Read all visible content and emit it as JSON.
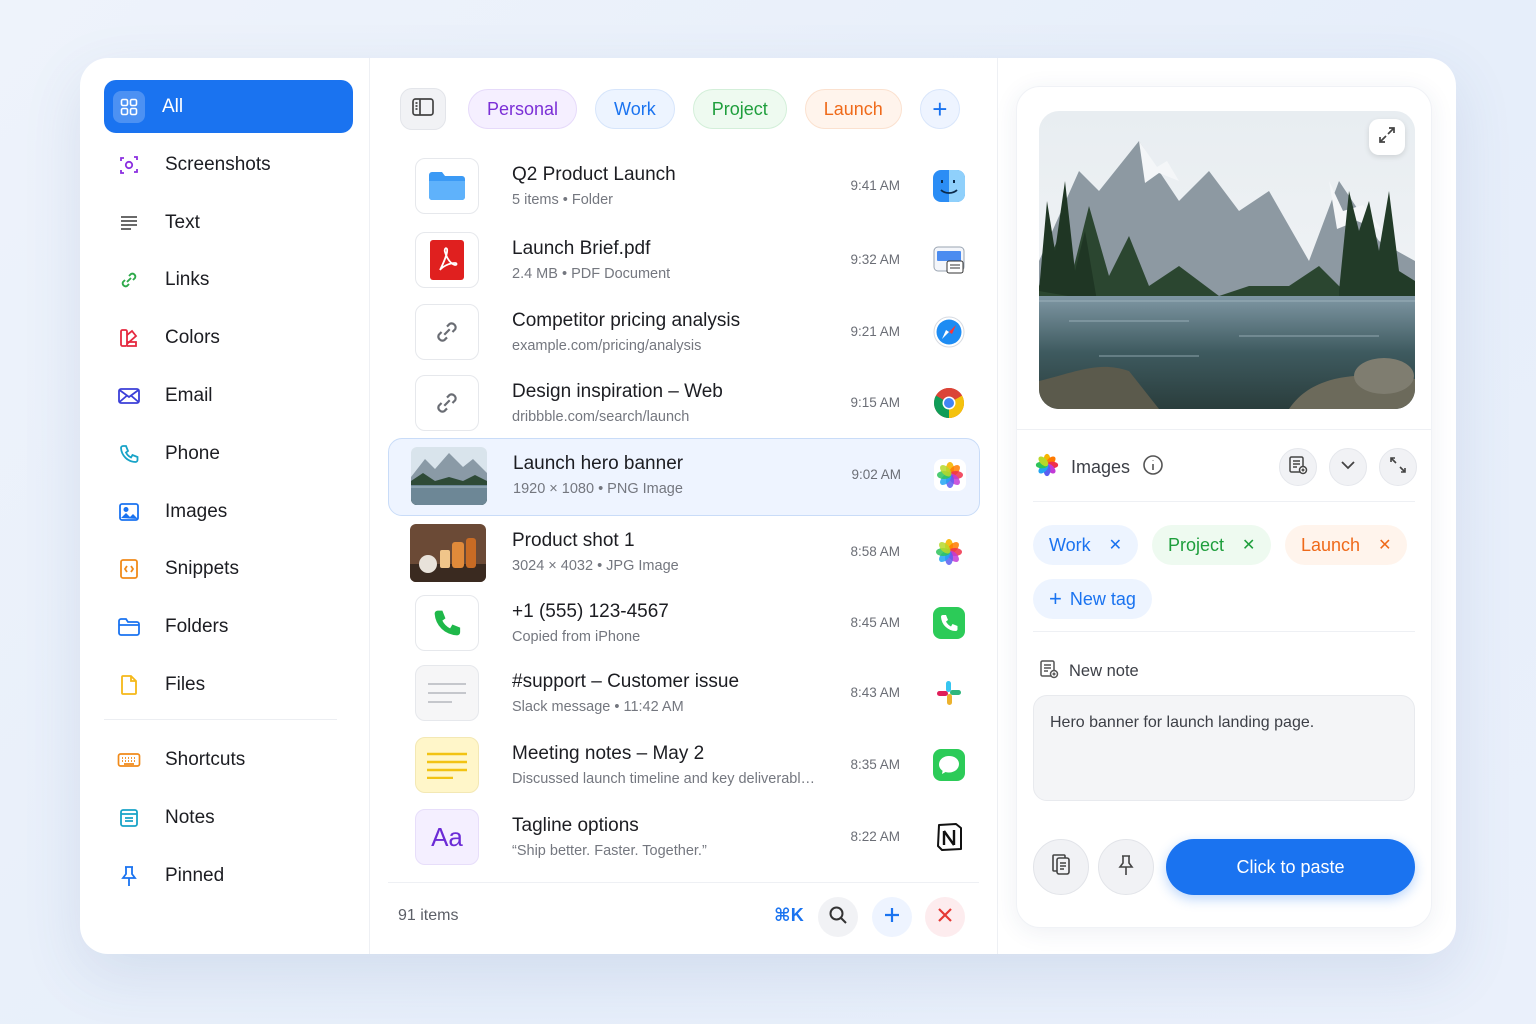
{
  "sidebar": {
    "items": [
      {
        "label": "All",
        "icon": "grid-icon"
      },
      {
        "label": "Screenshots",
        "icon": "screenshot-icon"
      },
      {
        "label": "Text",
        "icon": "text-lines-icon"
      },
      {
        "label": "Links",
        "icon": "link-icon"
      },
      {
        "label": "Colors",
        "icon": "palette-icon"
      },
      {
        "label": "Email",
        "icon": "envelope-icon"
      },
      {
        "label": "Phone",
        "icon": "phone-icon"
      },
      {
        "label": "Images",
        "icon": "image-icon"
      },
      {
        "label": "Snippets",
        "icon": "code-snippet-icon"
      },
      {
        "label": "Folders",
        "icon": "folder-icon"
      },
      {
        "label": "Files",
        "icon": "file-icon"
      }
    ],
    "secondary": [
      {
        "label": "Shortcuts",
        "icon": "keyboard-icon"
      },
      {
        "label": "Notes",
        "icon": "note-icon"
      },
      {
        "label": "Pinned",
        "icon": "pin-icon"
      }
    ]
  },
  "tagbar": {
    "tags": [
      "Personal",
      "Work",
      "Project",
      "Launch"
    ],
    "add": "+"
  },
  "list": {
    "rows": [
      {
        "title": "Q2 Product Launch",
        "sub": "5 items  •  Folder",
        "time": "9:41 AM",
        "app": "finder-icon"
      },
      {
        "title": "Launch Brief.pdf",
        "sub": "2.4 MB  •  PDF Document",
        "time": "9:32 AM",
        "app": "preview-app-icon"
      },
      {
        "title": "Competitor pricing analysis",
        "sub": "example.com/pricing/analysis",
        "time": "9:21 AM",
        "app": "safari-icon"
      },
      {
        "title": "Design inspiration – Web",
        "sub": "dribbble.com/search/launch",
        "time": "9:15 AM",
        "app": "chrome-icon"
      },
      {
        "title": "Launch hero banner",
        "sub": "1920 × 1080  •  PNG Image",
        "time": "9:02 AM",
        "app": "photos-icon"
      },
      {
        "title": "Product shot 1",
        "sub": "3024 × 4032  •  JPG Image",
        "time": "8:58 AM",
        "app": "photos-icon"
      },
      {
        "title": "+1 (555) 123-4567",
        "sub": "Copied from iPhone",
        "time": "8:45 AM",
        "app": "phone-app-icon"
      },
      {
        "title": "#support – Customer issue",
        "sub": "Slack message  •  11:42 AM",
        "time": "8:43 AM",
        "app": "slack-icon"
      },
      {
        "title": "Meeting notes – May 2",
        "sub": "Discussed launch timeline and key deliverables...",
        "time": "8:35 AM",
        "app": "messages-icon"
      },
      {
        "title": "Tagline options",
        "sub": "“Ship better. Faster. Together.”",
        "time": "8:22 AM",
        "app": "notion-icon"
      }
    ],
    "footer": {
      "count": "91 items",
      "shortcut": "⌘K"
    }
  },
  "detail": {
    "category": "Images",
    "tags": [
      "Work",
      "Project",
      "Launch"
    ],
    "new_tag": "New tag",
    "note_label": "New note",
    "note_text": "Hero banner for launch landing page.",
    "paste_label": "Click to paste"
  },
  "colors": {
    "accent": "#1a73f0",
    "personal": "#7b2fd6",
    "work": "#1a73f0",
    "project": "#1e9e3c",
    "launch": "#ef6a1a",
    "danger": "#e53935"
  }
}
